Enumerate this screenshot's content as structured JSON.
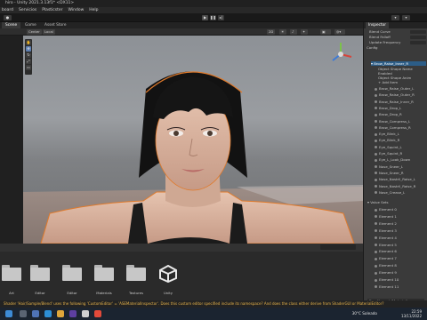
{
  "window": {
    "title": "hiro - Unity 2021.3.13f1* <DX11>"
  },
  "menu": [
    "board",
    "Servicios",
    "Plasticster",
    "Window",
    "Help"
  ],
  "toolbar": {
    "play_icon": "play-icon",
    "pause_icon": "pause-icon",
    "step_icon": "step-icon"
  },
  "scene_tabs": [
    {
      "label": "Scene",
      "selected": true
    },
    {
      "label": "Game",
      "selected": false
    },
    {
      "label": "Asset Store",
      "selected": false
    }
  ],
  "scene_toolbar": {
    "shading_label": "Center",
    "pivot_label": "Local",
    "mode_2d": "2D"
  },
  "inspector": {
    "tab_label": "Inspector",
    "properties": [
      {
        "label": "Blend Curve"
      },
      {
        "label": "Blend Falloff"
      },
      {
        "label": "Update Frequency"
      },
      {
        "label": "Config"
      }
    ],
    "blendshape_header": "▾ Brow_Raise_Inner_R",
    "blendshape_props": [
      {
        "label": "Object Shape Name"
      },
      {
        "label": "Enabled"
      },
      {
        "label": "Object Shape Anim"
      },
      {
        "label": "+ Add Item"
      }
    ],
    "blendshapes": [
      "Brow_Raise_Outer_L",
      "Brow_Raise_Outer_R",
      "Brow_Raise_Inner_R",
      "Brow_Drop_L",
      "Brow_Drop_R",
      "Brow_Compress_L",
      "Brow_Compress_R",
      "Eye_Blink_L",
      "Eye_Blink_R",
      "Eye_Squint_L",
      "Eye_Squint_R",
      "Eye_L_Look_Down",
      "Nose_Sneer_L",
      "Nose_Sneer_R",
      "Nose_Nostril_Raise_L",
      "Nose_Nostril_Raise_R",
      "Nose_Crease_L"
    ],
    "value_sets_header": "▾ Value Sets",
    "elements": [
      "Element 0",
      "Element 1",
      "Element 2",
      "Element 3",
      "Element 4",
      "Element 5",
      "Element 6",
      "Element 7",
      "Element 8",
      "Element 9",
      "Element 10",
      "Element 11"
    ],
    "footer_label": "Eye_Normal (Material)"
  },
  "project": {
    "folders": [
      {
        "label": "Art",
        "icon": "folder-icon"
      },
      {
        "label": "Editor",
        "icon": "folder-icon"
      },
      {
        "label": "Editor",
        "icon": "folder-icon"
      },
      {
        "label": "Materials",
        "icon": "folder-icon"
      },
      {
        "label": "Textures",
        "icon": "folder-icon"
      },
      {
        "label": "Unity",
        "icon": "unity-logo-icon"
      }
    ]
  },
  "status": {
    "message": "Shader 'Hair/Sample/Blend' uses the following 'CustomEditor' = 'ASEMaterialInspector'. Does this custom editor specified include its namespace? And does the class either derive from ShaderGUI or MaterialEditor?"
  },
  "taskbar": {
    "weather": "30°C Soleado",
    "time": "22:59",
    "date": "13/11/2022"
  },
  "colors": {
    "accent": "#2c5d87",
    "status_warning": "#e6b24a",
    "outline": "#e07a2b"
  }
}
